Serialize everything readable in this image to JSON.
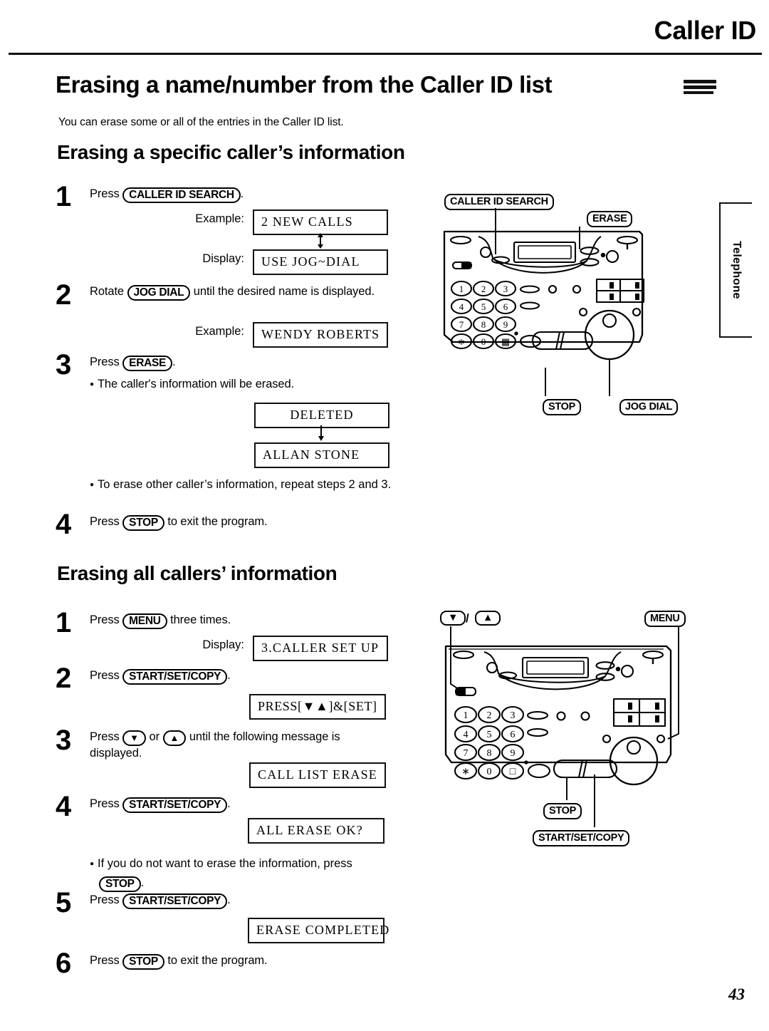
{
  "header": {
    "chapter": "Caller ID",
    "page_number": "43"
  },
  "title": {
    "text": "Erasing a name/number from the Caller ID list",
    "decoration": "triple-bar"
  },
  "intro": "You can erase some or all of the entries in the Caller ID list.",
  "side_tab": {
    "label": "Telephone"
  },
  "sections": [
    {
      "heading": "Erasing a specific caller’s information",
      "steps": [
        {
          "num": "1",
          "pre": "Press",
          "key": "CALLER ID SEARCH",
          "post": "."
        },
        {
          "num": "2",
          "pre": "Rotate",
          "key": "JOG DIAL",
          "post": " until the desired name is displayed."
        },
        {
          "num": "3",
          "pre": "Press",
          "key": "ERASE",
          "post": ".",
          "bullets": [
            "The caller's information will be erased.",
            "To erase other caller’s information, repeat steps 2 and 3."
          ]
        },
        {
          "num": "4",
          "pre": "Press",
          "key": "STOP",
          "post": " to exit the program."
        }
      ],
      "displays": [
        {
          "label": "Example:",
          "text": "2 NEW CALLS",
          "align": "left"
        },
        {
          "label": "Display:",
          "text": "USE JOG~DIAL",
          "align": "left"
        },
        {
          "label": "Example:",
          "text": "WENDY ROBERTS",
          "align": "left"
        },
        {
          "label": "",
          "text": "DELETED",
          "align": "center"
        },
        {
          "label": "",
          "text": "ALLAN STONE",
          "align": "left"
        }
      ]
    },
    {
      "heading": "Erasing all callers’ information",
      "steps": [
        {
          "num": "1",
          "pre": "Press",
          "key": "MENU",
          "post": " three times."
        },
        {
          "num": "2",
          "pre": "Press",
          "key": "START/SET/COPY",
          "post": "."
        },
        {
          "num": "3",
          "pre": "Press",
          "key": "▼",
          "mid": " or ",
          "key2": "▲",
          "post": " until the following message is displayed."
        },
        {
          "num": "4",
          "pre": "Press",
          "key": "START/SET/COPY",
          "post": ".",
          "bullets": [
            "If you do not want to erase the information, press"
          ],
          "bullet_key": "STOP",
          "bullet_key_post": "."
        },
        {
          "num": "5",
          "pre": "Press",
          "key": "START/SET/COPY",
          "post": "."
        },
        {
          "num": "6",
          "pre": "Press",
          "key": "STOP",
          "post": " to exit the program."
        }
      ],
      "displays": [
        {
          "label": "Display:",
          "text": "3.CALLER SET UP",
          "align": "left"
        },
        {
          "label": "",
          "text": "PRESS[▼▲]&[SET]",
          "align": "left"
        },
        {
          "label": "",
          "text": "CALL LIST ERASE",
          "align": "left"
        },
        {
          "label": "",
          "text": "ALL ERASE OK?",
          "align": "left"
        },
        {
          "label": "",
          "text": "ERASE COMPLETED",
          "align": "left"
        }
      ]
    }
  ],
  "diagram_top": {
    "name": "fax-machine-control-panel-top",
    "callouts": [
      {
        "id": "caller-id-search",
        "label": "CALLER ID SEARCH"
      },
      {
        "id": "erase",
        "label": "ERASE"
      },
      {
        "id": "stop",
        "label": "STOP"
      },
      {
        "id": "jog-dial",
        "label": "JOG DIAL"
      }
    ],
    "keypad": [
      [
        "1",
        "2",
        "3"
      ],
      [
        "4",
        "5",
        "6"
      ],
      [
        "7",
        "8",
        "9"
      ],
      [
        "∗",
        "0",
        "⌷"
      ]
    ]
  },
  "diagram_bottom": {
    "name": "fax-machine-control-panel-bottom",
    "callouts": [
      {
        "id": "down-arrow",
        "label": "▼"
      },
      {
        "id": "up-arrow",
        "label": "▲"
      },
      {
        "id": "menu",
        "label": "MENU"
      },
      {
        "id": "stop",
        "label": "STOP"
      },
      {
        "id": "start-set-copy",
        "label": "START/SET/COPY"
      }
    ],
    "separator": "/",
    "keypad": [
      [
        "1",
        "2",
        "3"
      ],
      [
        "4",
        "5",
        "6"
      ],
      [
        "7",
        "8",
        "9"
      ],
      [
        "∗",
        "0",
        "□"
      ]
    ]
  },
  "colors": {
    "ink": "#000000",
    "paper": "#ffffff"
  }
}
